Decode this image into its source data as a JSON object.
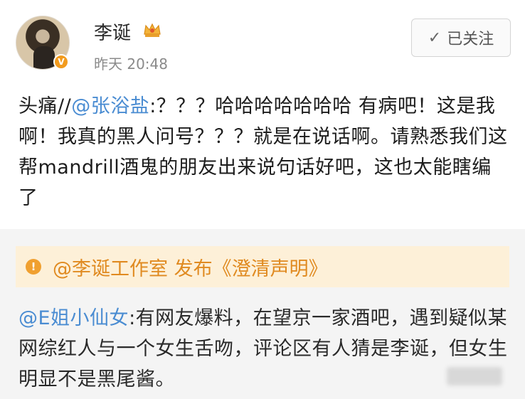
{
  "header": {
    "username": "李诞",
    "time": "昨天 20:48",
    "follow_label": "已关注",
    "verified_badge": "V"
  },
  "post": {
    "prefix": "头痛//",
    "mention": "@张浴盐",
    "body": ":？？？哈哈哈哈哈哈哈 有病吧！这是我啊！我真的黑人问号？？？就是在说话啊。请熟悉我们这帮mandrill酒鬼的朋友出来说句话好吧，这也太能瞎编了"
  },
  "repost": {
    "announcement": "@李诞工作室 发布《澄清声明》",
    "mention": "@E姐小仙女",
    "body": ":有网友爆料，在望京一家酒吧，遇到疑似某网综红人与一个女生舌吻，评论区有人猜是李诞，但女生明显不是黑尾酱。"
  },
  "colors": {
    "link": "#4a8cd2",
    "announce_bg": "#fdf0d8",
    "announce_text": "#e08a20",
    "badge": "#f29b1e"
  }
}
